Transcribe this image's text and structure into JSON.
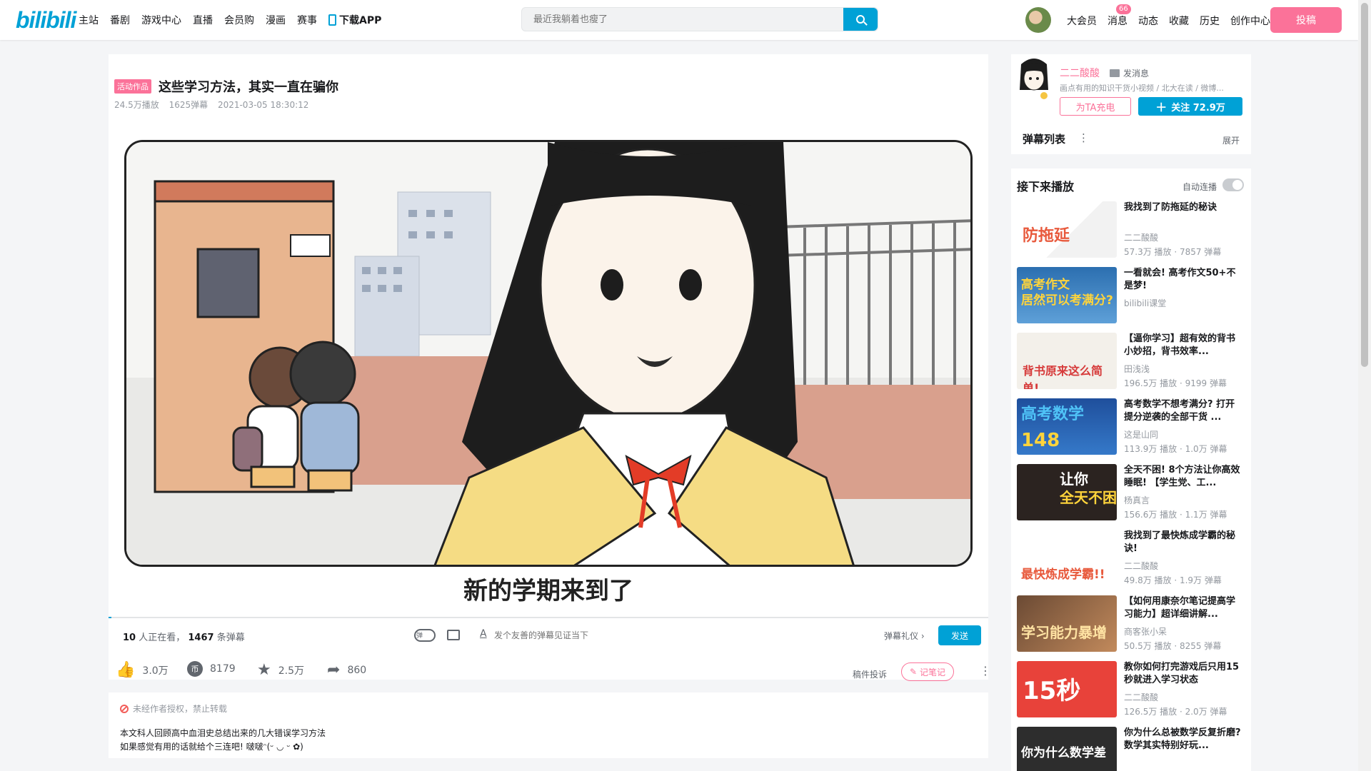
{
  "nav": {
    "logo": "bilibili",
    "items": [
      "主站",
      "番剧",
      "游戏中心",
      "直播",
      "会员购",
      "漫画",
      "赛事"
    ],
    "app_label": "下载APP",
    "search_placeholder": "最近我躺着也瘦了",
    "right_items": [
      "大会员",
      "消息",
      "动态",
      "收藏",
      "历史",
      "创作中心"
    ],
    "msg_badge": "66",
    "upload_label": "投稿"
  },
  "video": {
    "tag": "活动作品",
    "title": "这些学习方法，其实一直在骗你",
    "plays": "24.5万播放",
    "danmaku_count": "1625弹幕",
    "date": "2021-03-05 18:30:12",
    "subtitle": "新的学期来到了",
    "progress": 0.003
  },
  "danmaku_bar": {
    "viewers": "10",
    "viewers_suffix": "人正在看，",
    "dm_count": "1467",
    "dm_suffix": "条弹幕",
    "input_placeholder": "发个友善的弹幕见证当下",
    "etiquette": "弹幕礼仪 ›",
    "send": "发送"
  },
  "toolbar": {
    "like": "3.0万",
    "coin": "8179",
    "favorite": "2.5万",
    "share": "860",
    "complain": "稿件投诉",
    "note": "记笔记"
  },
  "description": {
    "copyright": "未经作者授权，禁止转载",
    "line1": "本文科人回顾高中血泪史总结出来的几大错误学习方法",
    "line2": "如果感觉有用的话就给个三连吧! 啵啵ᵔ(ᵕ ◡ ᵕ ✿)"
  },
  "up": {
    "name": "二二酸酸",
    "send_msg": "发消息",
    "desc": "画点有用的知识干货小视频 / 北大在读 / 微博...",
    "charge": "为TA充电",
    "follow": "关注 72.9万",
    "dm_list": "弹幕列表",
    "expand": "展开"
  },
  "next": {
    "title": "接下来播放",
    "autoplay": "自动连播",
    "items": [
      {
        "title": "我找到了防拖延的秘诀",
        "up": "二二酸酸",
        "stats": "57.3万 播放 · 7857 弹幕"
      },
      {
        "title": "一看就会! 高考作文50+不是梦!",
        "up": "bilibili课堂",
        "stats": ""
      },
      {
        "title": "【逼你学习】超有效的背书小妙招，背书效率...",
        "up": "田浅浅",
        "stats": "196.5万 播放 · 9199 弹幕"
      },
      {
        "title": "高考数学不想考满分? 打开提分逆袭的全部干货 ...",
        "up": "这是山同",
        "stats": "113.9万 播放 · 1.0万 弹幕"
      },
      {
        "title": "全天不困! 8个方法让你高效睡眠! 【学生党、工...",
        "up": "杨真言",
        "stats": "156.6万 播放 · 1.1万 弹幕"
      },
      {
        "title": "我找到了最快炼成学霸的秘诀!",
        "up": "二二酸酸",
        "stats": "49.8万 播放 · 1.9万 弹幕"
      },
      {
        "title": "【如何用康奈尔笔记提高学习能力】超详细讲解...",
        "up": "商客张小呆",
        "stats": "50.5万 播放 · 8255 弹幕"
      },
      {
        "title": "教你如何打完游戏后只用15秒就进入学习状态",
        "up": "二二酸酸",
        "stats": "126.5万 播放 · 2.0万 弹幕"
      },
      {
        "title": "你为什么总被数学反复折磨? 数学其实特别好玩...",
        "up": "",
        "stats": ""
      }
    ]
  },
  "colors": {
    "accent": "#00a1d6",
    "pink": "#fb7299"
  }
}
